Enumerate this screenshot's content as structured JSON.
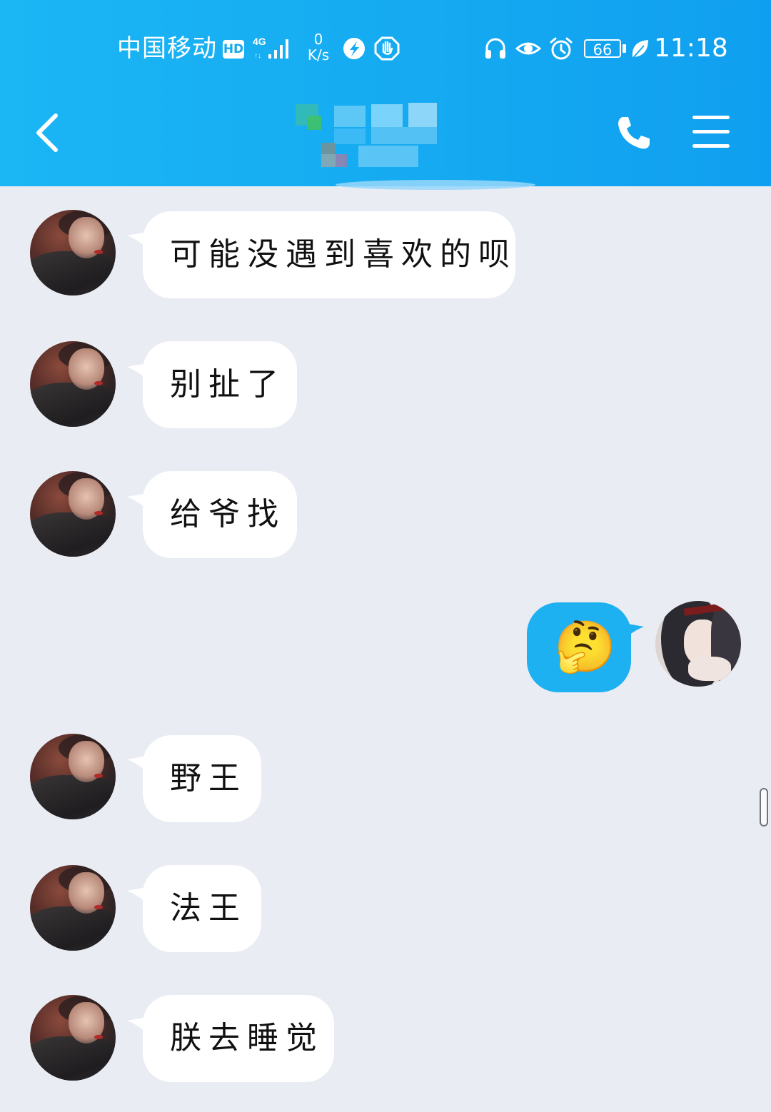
{
  "status_bar": {
    "carrier": "中国移动",
    "hd_badge": "HD",
    "network": "4G",
    "net_speed_value": "0",
    "net_speed_unit": "K/s",
    "battery_level": "66",
    "time": "11:18",
    "icons": [
      "hd-icon",
      "signal-icon",
      "app-s-icon",
      "hand-stop-icon",
      "headset-icon",
      "eye-icon",
      "alarm-icon",
      "battery-icon",
      "leaf-icon"
    ]
  },
  "nav": {
    "title": "",
    "back_icon": "chevron-left-icon",
    "call_icon": "phone-icon",
    "menu_icon": "menu-icon"
  },
  "messages": [
    {
      "direction": "in",
      "text": "可能没遇到喜欢的呗"
    },
    {
      "direction": "in",
      "text": "别扯了"
    },
    {
      "direction": "in",
      "text": "给爷找"
    },
    {
      "direction": "out",
      "text": "🤔"
    },
    {
      "direction": "in",
      "text": "野王"
    },
    {
      "direction": "in",
      "text": "法王"
    },
    {
      "direction": "in",
      "text": "朕去睡觉"
    }
  ],
  "colors": {
    "header": "#15aaf1",
    "background": "#e9ecf3",
    "incoming_bubble": "#ffffff",
    "outgoing_bubble": "#1eb1f2"
  }
}
